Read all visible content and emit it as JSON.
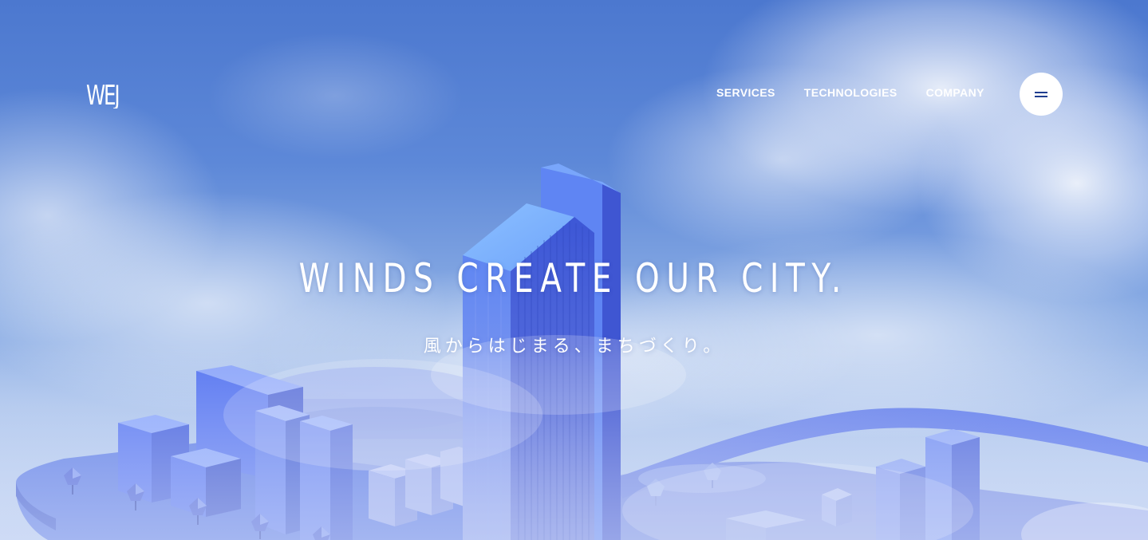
{
  "header": {
    "logo_text": "WEJ",
    "nav": [
      {
        "label": "SERVICES"
      },
      {
        "label": "TECHNOLOGIES"
      },
      {
        "label": "COMPANY"
      }
    ],
    "menu_icon": "menu-icon"
  },
  "hero": {
    "headline": "WINDS CREATE OUR CITY.",
    "subline": "風からはじまる、まちづくり。"
  },
  "colors": {
    "sky_top": "#4c78cf",
    "sky_bottom": "#b9cdf0",
    "building": "#5a7df0",
    "text": "#ffffff",
    "menu_bars": "#1f3d8f"
  }
}
